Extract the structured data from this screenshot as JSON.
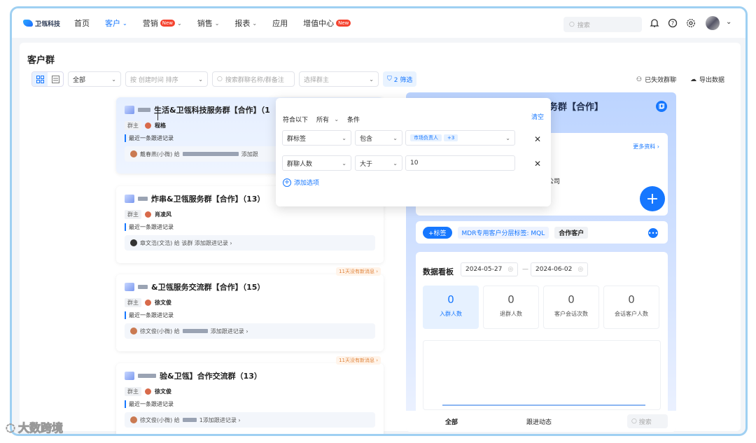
{
  "logo": {
    "text": "卫瓴科技"
  },
  "nav": [
    {
      "label": "首页"
    },
    {
      "label": "客户"
    },
    {
      "label": "营销",
      "badge": "New"
    },
    {
      "label": "销售"
    },
    {
      "label": "报表"
    },
    {
      "label": "应用"
    },
    {
      "label": "增值中心",
      "badge": "New"
    }
  ],
  "top": {
    "search_placeholder": "搜索"
  },
  "page": {
    "title": "客户群"
  },
  "toolbar": {
    "scope": "全部",
    "sort_placeholder": "按 创建时间 排序",
    "search_placeholder": "搜索群聊名称/群备注",
    "owner_placeholder": "选择群主",
    "filter_label": "2 筛选",
    "lost_label": "已失效群聊",
    "export_label": "导出数据"
  },
  "groups": [
    {
      "title": "生活&卫瓴科技服务群【合作】（1",
      "owner_label": "群主",
      "owner": "程格",
      "recent": "最近一条跟进记录",
      "follow": "戴春燕(小微) 给",
      "follow_suffix": "添加跟",
      "stale": ""
    },
    {
      "title": "炸串&卫瓴服务群【合作】（13）",
      "owner_label": "群主",
      "owner": "肖凌风",
      "recent": "最近一条跟进记录",
      "follow": "章文浩(文浩) 给 该群 添加跟进记录 ›",
      "follow_suffix": "",
      "stale": ""
    },
    {
      "title": "&卫瓴服务交流群【合作】（15）",
      "owner_label": "群主",
      "owner": "徐文俊",
      "recent": "最近一条跟进记录",
      "follow": "徐文俊(小微) 给",
      "follow_suffix": "添加跟进记录 ›",
      "stale": "11天没有新消息 ›"
    },
    {
      "title": "验&卫瓴】合作交流群（13）",
      "owner_label": "群主",
      "owner": "徐文俊",
      "recent": "最近一条跟进记录",
      "follow": "徐文俊(小微) 给",
      "follow_suffix": "1添加跟进记录 ›",
      "stale": "11天没有新消息 ›"
    }
  ],
  "filter": {
    "match_prefix": "符合以下",
    "match_mode": "所有",
    "match_suffix": "条件",
    "clear": "清空",
    "rows": [
      {
        "field": "群标签",
        "op": "包含",
        "value": "市场负责人",
        "extra": "+3"
      },
      {
        "field": "群聊人数",
        "op": "大于",
        "value": "10",
        "extra": ""
      }
    ],
    "add_option": "添加选项"
  },
  "detail": {
    "title": "务群【合作】",
    "more_info": "更多资料 ›",
    "company": "公司",
    "add_tag": "+标签",
    "tag1": "MDR专用客户分层标签: MQL",
    "tag2": "合作客户",
    "dashboard": {
      "title": "数据看板",
      "start_date": "2024-05-27",
      "end_date": "2024-06-02",
      "sep": "—",
      "stats": [
        {
          "value": "0",
          "label": "入群人数"
        },
        {
          "value": "0",
          "label": "退群人数"
        },
        {
          "value": "0",
          "label": "客户会话次数"
        },
        {
          "value": "0",
          "label": "会话客户人数"
        }
      ]
    },
    "tabs": [
      "全部",
      "跟进动态"
    ],
    "search_placeholder": "搜索"
  },
  "watermark": "大数跨境",
  "colors": {
    "accent": "#1677ff",
    "badge": "#f5432f",
    "stale": "#e0833a"
  }
}
